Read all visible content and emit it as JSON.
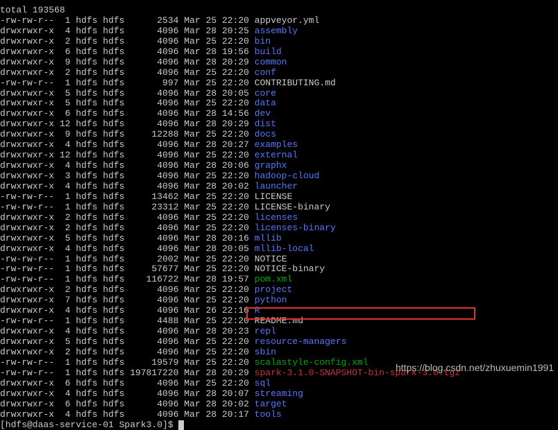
{
  "header_truncated": "",
  "total_line": "total 193568",
  "rows": [
    {
      "perm": "-rw-rw-r--",
      "links": "1",
      "owner": "hdfs",
      "group": "hdfs",
      "size": "2534",
      "date": "Mar",
      "day": "25",
      "time": "22:20",
      "name": "appveyor.yml",
      "cls": ""
    },
    {
      "perm": "drwxrwxr-x",
      "links": "4",
      "owner": "hdfs",
      "group": "hdfs",
      "size": "4096",
      "date": "Mar",
      "day": "28",
      "time": "20:25",
      "name": "assembly",
      "cls": "dir"
    },
    {
      "perm": "drwxrwxr-x",
      "links": "2",
      "owner": "hdfs",
      "group": "hdfs",
      "size": "4096",
      "date": "Mar",
      "day": "25",
      "time": "22:20",
      "name": "bin",
      "cls": "dir"
    },
    {
      "perm": "drwxrwxr-x",
      "links": "6",
      "owner": "hdfs",
      "group": "hdfs",
      "size": "4096",
      "date": "Mar",
      "day": "28",
      "time": "19:56",
      "name": "build",
      "cls": "dir"
    },
    {
      "perm": "drwxrwxr-x",
      "links": "9",
      "owner": "hdfs",
      "group": "hdfs",
      "size": "4096",
      "date": "Mar",
      "day": "28",
      "time": "20:29",
      "name": "common",
      "cls": "dir"
    },
    {
      "perm": "drwxrwxr-x",
      "links": "2",
      "owner": "hdfs",
      "group": "hdfs",
      "size": "4096",
      "date": "Mar",
      "day": "25",
      "time": "22:20",
      "name": "conf",
      "cls": "dir"
    },
    {
      "perm": "-rw-rw-r--",
      "links": "1",
      "owner": "hdfs",
      "group": "hdfs",
      "size": "997",
      "date": "Mar",
      "day": "25",
      "time": "22:20",
      "name": "CONTRIBUTING.md",
      "cls": ""
    },
    {
      "perm": "drwxrwxr-x",
      "links": "5",
      "owner": "hdfs",
      "group": "hdfs",
      "size": "4096",
      "date": "Mar",
      "day": "28",
      "time": "20:05",
      "name": "core",
      "cls": "dir"
    },
    {
      "perm": "drwxrwxr-x",
      "links": "5",
      "owner": "hdfs",
      "group": "hdfs",
      "size": "4096",
      "date": "Mar",
      "day": "25",
      "time": "22:20",
      "name": "data",
      "cls": "dir"
    },
    {
      "perm": "drwxrwxr-x",
      "links": "6",
      "owner": "hdfs",
      "group": "hdfs",
      "size": "4096",
      "date": "Mar",
      "day": "28",
      "time": "14:56",
      "name": "dev",
      "cls": "dir"
    },
    {
      "perm": "drwxrwxr-x",
      "links": "12",
      "owner": "hdfs",
      "group": "hdfs",
      "size": "4096",
      "date": "Mar",
      "day": "28",
      "time": "20:29",
      "name": "dist",
      "cls": "dir"
    },
    {
      "perm": "drwxrwxr-x",
      "links": "9",
      "owner": "hdfs",
      "group": "hdfs",
      "size": "12288",
      "date": "Mar",
      "day": "25",
      "time": "22:20",
      "name": "docs",
      "cls": "dir"
    },
    {
      "perm": "drwxrwxr-x",
      "links": "4",
      "owner": "hdfs",
      "group": "hdfs",
      "size": "4096",
      "date": "Mar",
      "day": "28",
      "time": "20:27",
      "name": "examples",
      "cls": "dir"
    },
    {
      "perm": "drwxrwxr-x",
      "links": "12",
      "owner": "hdfs",
      "group": "hdfs",
      "size": "4096",
      "date": "Mar",
      "day": "25",
      "time": "22:20",
      "name": "external",
      "cls": "dir"
    },
    {
      "perm": "drwxrwxr-x",
      "links": "4",
      "owner": "hdfs",
      "group": "hdfs",
      "size": "4096",
      "date": "Mar",
      "day": "28",
      "time": "20:06",
      "name": "graphx",
      "cls": "dir"
    },
    {
      "perm": "drwxrwxr-x",
      "links": "3",
      "owner": "hdfs",
      "group": "hdfs",
      "size": "4096",
      "date": "Mar",
      "day": "25",
      "time": "22:20",
      "name": "hadoop-cloud",
      "cls": "dir"
    },
    {
      "perm": "drwxrwxr-x",
      "links": "4",
      "owner": "hdfs",
      "group": "hdfs",
      "size": "4096",
      "date": "Mar",
      "day": "28",
      "time": "20:02",
      "name": "launcher",
      "cls": "dir"
    },
    {
      "perm": "-rw-rw-r--",
      "links": "1",
      "owner": "hdfs",
      "group": "hdfs",
      "size": "13462",
      "date": "Mar",
      "day": "25",
      "time": "22:20",
      "name": "LICENSE",
      "cls": ""
    },
    {
      "perm": "-rw-rw-r--",
      "links": "1",
      "owner": "hdfs",
      "group": "hdfs",
      "size": "23312",
      "date": "Mar",
      "day": "25",
      "time": "22:20",
      "name": "LICENSE-binary",
      "cls": ""
    },
    {
      "perm": "drwxrwxr-x",
      "links": "2",
      "owner": "hdfs",
      "group": "hdfs",
      "size": "4096",
      "date": "Mar",
      "day": "25",
      "time": "22:20",
      "name": "licenses",
      "cls": "dir"
    },
    {
      "perm": "drwxrwxr-x",
      "links": "2",
      "owner": "hdfs",
      "group": "hdfs",
      "size": "4096",
      "date": "Mar",
      "day": "25",
      "time": "22:20",
      "name": "licenses-binary",
      "cls": "dir"
    },
    {
      "perm": "drwxrwxr-x",
      "links": "5",
      "owner": "hdfs",
      "group": "hdfs",
      "size": "4096",
      "date": "Mar",
      "day": "28",
      "time": "20:16",
      "name": "mllib",
      "cls": "dir"
    },
    {
      "perm": "drwxrwxr-x",
      "links": "4",
      "owner": "hdfs",
      "group": "hdfs",
      "size": "4096",
      "date": "Mar",
      "day": "28",
      "time": "20:05",
      "name": "mllib-local",
      "cls": "dir"
    },
    {
      "perm": "-rw-rw-r--",
      "links": "1",
      "owner": "hdfs",
      "group": "hdfs",
      "size": "2002",
      "date": "Mar",
      "day": "25",
      "time": "22:20",
      "name": "NOTICE",
      "cls": ""
    },
    {
      "perm": "-rw-rw-r--",
      "links": "1",
      "owner": "hdfs",
      "group": "hdfs",
      "size": "57677",
      "date": "Mar",
      "day": "25",
      "time": "22:20",
      "name": "NOTICE-binary",
      "cls": ""
    },
    {
      "perm": "-rw-rw-r--",
      "links": "1",
      "owner": "hdfs",
      "group": "hdfs",
      "size": "116722",
      "date": "Mar",
      "day": "28",
      "time": "19:57",
      "name": "pom.xml",
      "cls": "xml"
    },
    {
      "perm": "drwxrwxr-x",
      "links": "2",
      "owner": "hdfs",
      "group": "hdfs",
      "size": "4096",
      "date": "Mar",
      "day": "25",
      "time": "22:20",
      "name": "project",
      "cls": "dir"
    },
    {
      "perm": "drwxrwxr-x",
      "links": "7",
      "owner": "hdfs",
      "group": "hdfs",
      "size": "4096",
      "date": "Mar",
      "day": "25",
      "time": "22:20",
      "name": "python",
      "cls": "dir"
    },
    {
      "perm": "drwxrwxr-x",
      "links": "4",
      "owner": "hdfs",
      "group": "hdfs",
      "size": "4096",
      "date": "Mar",
      "day": "26",
      "time": "22:16",
      "name": "R",
      "cls": "dir"
    },
    {
      "perm": "-rw-rw-r--",
      "links": "1",
      "owner": "hdfs",
      "group": "hdfs",
      "size": "4488",
      "date": "Mar",
      "day": "25",
      "time": "22:20",
      "name": "README.md",
      "cls": ""
    },
    {
      "perm": "drwxrwxr-x",
      "links": "4",
      "owner": "hdfs",
      "group": "hdfs",
      "size": "4096",
      "date": "Mar",
      "day": "28",
      "time": "20:23",
      "name": "repl",
      "cls": "dir"
    },
    {
      "perm": "drwxrwxr-x",
      "links": "5",
      "owner": "hdfs",
      "group": "hdfs",
      "size": "4096",
      "date": "Mar",
      "day": "25",
      "time": "22:20",
      "name": "resource-managers",
      "cls": "dir"
    },
    {
      "perm": "drwxrwxr-x",
      "links": "2",
      "owner": "hdfs",
      "group": "hdfs",
      "size": "4096",
      "date": "Mar",
      "day": "25",
      "time": "22:20",
      "name": "sbin",
      "cls": "dir"
    },
    {
      "perm": "-rw-rw-r--",
      "links": "1",
      "owner": "hdfs",
      "group": "hdfs",
      "size": "19579",
      "date": "Mar",
      "day": "25",
      "time": "22:20",
      "name": "scalastyle-config.xml",
      "cls": "xml"
    },
    {
      "perm": "-rw-rw-r--",
      "links": "1",
      "owner": "hdfs",
      "group": "hdfs",
      "size": "197817220",
      "date": "Mar",
      "day": "28",
      "time": "20:29",
      "name": "spark-3.1.0-SNAPSHOT-bin-spark-3.0.tgz",
      "cls": "tgz"
    },
    {
      "perm": "drwxrwxr-x",
      "links": "6",
      "owner": "hdfs",
      "group": "hdfs",
      "size": "4096",
      "date": "Mar",
      "day": "25",
      "time": "22:20",
      "name": "sql",
      "cls": "dir"
    },
    {
      "perm": "drwxrwxr-x",
      "links": "4",
      "owner": "hdfs",
      "group": "hdfs",
      "size": "4096",
      "date": "Mar",
      "day": "28",
      "time": "20:07",
      "name": "streaming",
      "cls": "dir"
    },
    {
      "perm": "drwxrwxr-x",
      "links": "6",
      "owner": "hdfs",
      "group": "hdfs",
      "size": "4096",
      "date": "Mar",
      "day": "28",
      "time": "20:02",
      "name": "target",
      "cls": "dir"
    },
    {
      "perm": "drwxrwxr-x",
      "links": "4",
      "owner": "hdfs",
      "group": "hdfs",
      "size": "4096",
      "date": "Mar",
      "day": "28",
      "time": "20:17",
      "name": "tools",
      "cls": "dir"
    }
  ],
  "prompt": "[hdfs@daas-service-01 Spark3.0]$ ",
  "watermark": "https://blog.csdn.net/zhuxuemin1991"
}
